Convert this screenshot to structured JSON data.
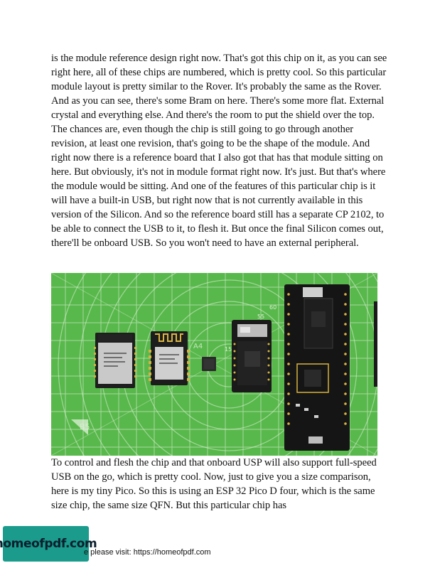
{
  "document": {
    "paragraphs": [
      "is the module reference design right now. That's got this chip on it, as you can see right here, all of these chips are numbered, which is pretty cool. So this particular module layout is pretty similar to the Rover. It's probably the same as the Rover. And as you can see, there's some Bram on here. There's some more flat. External crystal and everything else. And there's the room to put the shield over the top. The chances are, even though the chip is still going to go through another revision, at least one revision, that's going to be the shape of the module. And right now there is a reference board that I also got that has that module sitting on here. But obviously, it's not in module format right now. It's just. But that's where the module would be sitting. And one of the features of this particular chip is it will have a built-in USB, but right now that is not currently available in this version of the Silicon. And so the reference board still has a separate CP 2102, to be able to connect the USB to it, to flesh it. But once the final Silicon comes out, there'll be onboard USB. So you won't need to have an external peripheral.",
      "To control and flesh the chip and that onboard USP will also support full-speed USB on the go, which is pretty cool. Now, just to give you a size comparison, here is my tiny Pico. So this is using an ESP 32 Pico D four, which is the same size chip, the same size QFN. But this particular chip has"
    ]
  },
  "photo": {
    "mat_labels": [
      "A4",
      "B5",
      "60",
      "55",
      "50",
      "15"
    ],
    "colors": {
      "mat": "#58b84b",
      "mat_lines": "#e9f5e4",
      "pcb": "#1c1c1c",
      "chip": "#2b2b2b",
      "shield": "#c7c7c7",
      "gold": "#d8b340"
    }
  },
  "footer": {
    "logo": "homeofpdf.com",
    "text": "e please visit: https://homeofpdf.com"
  }
}
